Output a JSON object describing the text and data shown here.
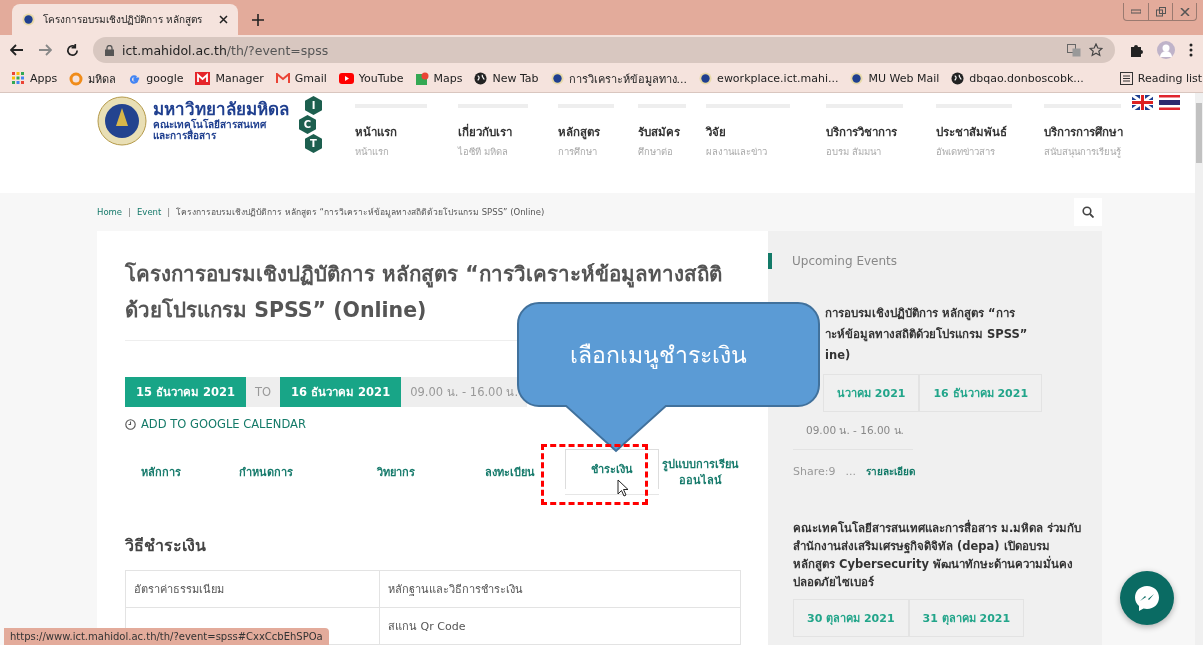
{
  "browser": {
    "tab": {
      "title": "โครงการอบรมเชิงปฏิบัติการ หลักสูตร"
    },
    "address": {
      "host": "ict.mahidol.ac.th",
      "path": "/th/?event=spss"
    },
    "bookmarks": [
      {
        "kind": "apps",
        "label": "Apps"
      },
      {
        "kind": "ring",
        "label": "มหิดล"
      },
      {
        "kind": "google",
        "label": "google"
      },
      {
        "kind": "red",
        "label": "Manager"
      },
      {
        "kind": "gmail",
        "label": "Gmail"
      },
      {
        "kind": "youtube",
        "label": "YouTube"
      },
      {
        "kind": "maps",
        "label": "Maps"
      },
      {
        "kind": "globe",
        "label": "New Tab"
      },
      {
        "kind": "seal",
        "label": "การวิเคราะห์ข้อมูลทาง..."
      },
      {
        "kind": "seal",
        "label": "eworkplace.ict.mahi..."
      },
      {
        "kind": "seal",
        "label": "MU Web Mail"
      },
      {
        "kind": "globe",
        "label": "dbqao.donboscobk..."
      }
    ],
    "reading_list": "Reading list"
  },
  "header": {
    "logo": {
      "university": "มหาวิทยาลัยมหิดล",
      "faculty_line_1": "คณะเทคโนโลยีสารสนเทศ",
      "faculty_line_2": "และการสื่อสาร",
      "letters": [
        "I",
        "C",
        "T"
      ]
    },
    "nav": [
      {
        "label": "หน้าแรก",
        "sub": "หน้าแรก"
      },
      {
        "label": "เกี่ยวกับเรา",
        "sub": "ไอซีที มหิดล"
      },
      {
        "label": "หลักสูตร",
        "sub": "การศึกษา"
      },
      {
        "label": "รับสมัคร",
        "sub": "ศึกษาต่อ"
      },
      {
        "label": "วิจัย",
        "sub": "ผลงานและข่าว"
      },
      {
        "label": "บริการวิชาการ",
        "sub": "อบรม สัมมนา"
      },
      {
        "label": "ประชาสัมพันธ์",
        "sub": "อัพเดทข่าวสาร"
      },
      {
        "label": "บริการการศึกษา",
        "sub": "สนับสนุนการเรียนรู้"
      }
    ]
  },
  "breadcrumb_separator": "|",
  "breadcrumb": [
    "Home",
    "Event",
    "โครงการอบรมเชิงปฏิบัติการ หลักสูตร “การวิเคราะห์ข้อมูลทางสถิติด้วยโปรแกรม SPSS” (Online)"
  ],
  "event": {
    "title": "โครงการอบรมเชิงปฏิบัติการ หลักสูตร “การวิเคราะห์ข้อมูลทางสถิติด้วยโปรแกรม SPSS” (Online)",
    "start": "15 ธันวาคม 2021",
    "to": "TO",
    "end": "16 ธันวาคม 2021",
    "time": "09.00 น. - 16.00 น.",
    "calendar_link": "ADD TO GOOGLE CALENDAR",
    "tabs": [
      {
        "label": "หลักการ",
        "selected": false
      },
      {
        "label": "กำหนดการ",
        "selected": false
      },
      {
        "label": "วิทยากร",
        "selected": false
      },
      {
        "label": "ลงทะเบียน",
        "selected": false
      },
      {
        "label": "ชำระเงิน",
        "selected": true
      },
      {
        "label": "รูปแบบการเรียนออนไลน์",
        "selected": false
      }
    ],
    "section_heading": "วิธีชำระเงิน",
    "table": {
      "columns": [
        "อัตราค่าธรรมเนียม",
        "หลักฐานและวิธีการชำระเงิน"
      ],
      "rows": [
        {
          "method": "สแกน Qr Code"
        }
      ]
    }
  },
  "sidebar": {
    "heading": "Upcoming Events",
    "first_event": {
      "title_lines": [
        "การอบรมเชิงปฏิบัติการ หลักสูตร “การ",
        "าะห์ข้อมูลทางสถิติด้วยโปรแกรม SPSS”",
        "ine)"
      ],
      "start": "นวาคม 2021",
      "end": "16 ธันวาคม 2021",
      "time": "09.00 น. - 16.00 น.",
      "share": "Share:9",
      "dots": "...",
      "details_link": "รายละเอียด"
    },
    "second_event": {
      "title": "คณะเทคโนโลยีสารสนเทศและการสื่อสาร ม.มหิดล ร่วมกับ สำนักงานส่งเสริมเศรษฐกิจดิจิทัล (depa) เปิดอบรมหลักสูตร Cybersecurity พัฒนาทักษะด้านความมั่นคงปลอดภัยไซเบอร์",
      "start": "30 ตุลาคม 2021",
      "end": "31 ตุลาคม 2021"
    }
  },
  "callout": {
    "text": "เลือกเมนูชำระเงิน"
  },
  "status_url": "https://www.ict.mahidol.ac.th/th/?event=spss#CxxCcbEhSPOa"
}
